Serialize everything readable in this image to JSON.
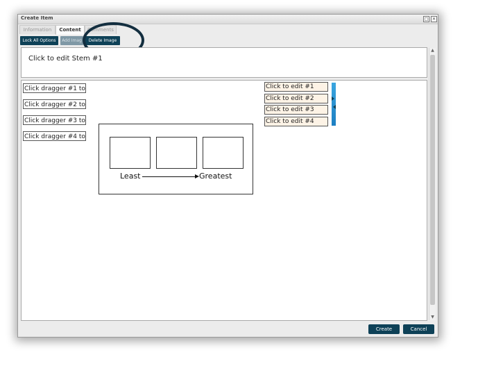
{
  "window": {
    "title": "Create Item"
  },
  "tabs": [
    {
      "label": "Information",
      "active": false
    },
    {
      "label": "Content",
      "active": true
    },
    {
      "label": "Comments",
      "active": false
    }
  ],
  "toolbar": {
    "lock_all_label": "Lock All Options",
    "add_image_label": "Add Imag",
    "delete_image_label": "Delete Image"
  },
  "stem": {
    "text": "Click to edit Stem #1"
  },
  "draggers": [
    "Click dragger #1 to",
    "Click dragger #2 to",
    "Click dragger #3 to",
    "Click dragger #4 to"
  ],
  "targets": [
    "Click to edit #1",
    "Click to edit #2",
    "Click to edit #3",
    "Click to edit #4"
  ],
  "image": {
    "left_label": "Least",
    "right_label": "Greatest"
  },
  "footer": {
    "create_label": "Create",
    "cancel_label": "Cancel"
  },
  "colors": {
    "primary_button": "#0e4157",
    "accent_bar": "#1d7fc2",
    "target_bg": "#fdf3e6"
  }
}
